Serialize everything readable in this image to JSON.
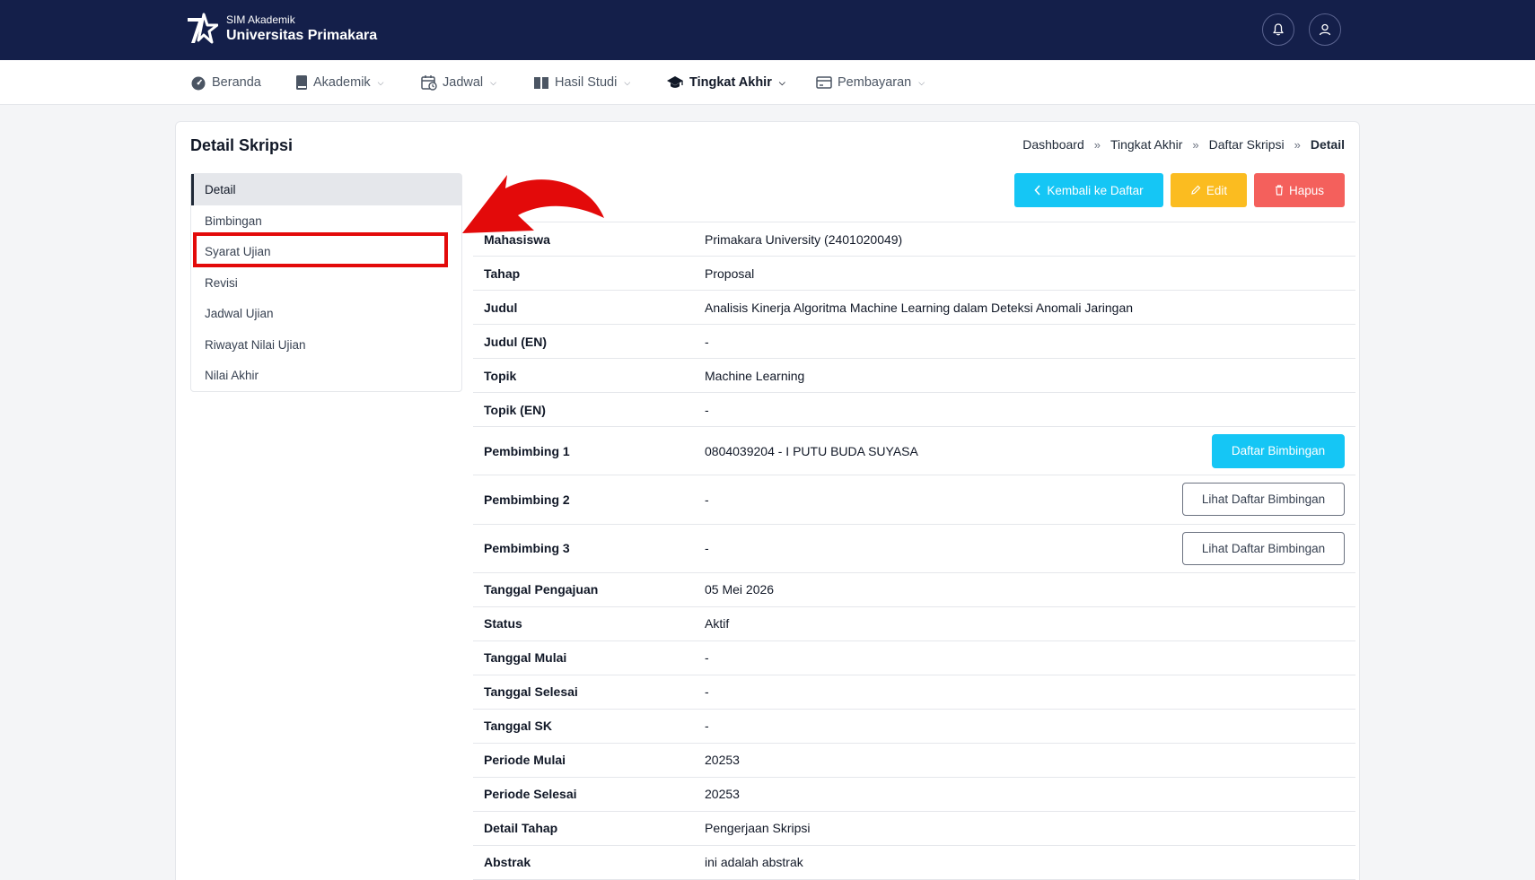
{
  "header": {
    "brand_sub": "SIM Akademik",
    "brand_name": "Universitas Primakara"
  },
  "nav": [
    {
      "label": "Beranda",
      "icon": "dashboard-icon",
      "dropdown": false
    },
    {
      "label": "Akademik",
      "icon": "book-icon",
      "dropdown": true
    },
    {
      "label": "Jadwal",
      "icon": "calendar-clock-icon",
      "dropdown": true
    },
    {
      "label": "Hasil Studi",
      "icon": "open-book-icon",
      "dropdown": true
    },
    {
      "label": "Tingkat Akhir",
      "icon": "graduation-cap-icon",
      "dropdown": true,
      "active": true
    },
    {
      "label": "Pembayaran",
      "icon": "wallet-icon",
      "dropdown": true
    }
  ],
  "page": {
    "title": "Detail Skripsi",
    "breadcrumb": [
      "Dashboard",
      "Tingkat Akhir",
      "Daftar Skripsi",
      "Detail"
    ]
  },
  "side_menu": [
    {
      "label": "Detail",
      "active": true
    },
    {
      "label": "Bimbingan"
    },
    {
      "label": "Syarat Ujian",
      "highlighted": true
    },
    {
      "label": "Revisi"
    },
    {
      "label": "Jadwal Ujian"
    },
    {
      "label": "Riwayat Nilai Ujian"
    },
    {
      "label": "Nilai Akhir"
    }
  ],
  "actions": {
    "back_label": "Kembali ke Daftar",
    "edit_label": "Edit",
    "delete_label": "Hapus"
  },
  "details": [
    {
      "label": "Mahasiswa",
      "value": "Primakara University (2401020049)"
    },
    {
      "label": "Tahap",
      "value": "Proposal"
    },
    {
      "label": "Judul",
      "value": "Analisis Kinerja Algoritma Machine Learning dalam Deteksi Anomali Jaringan"
    },
    {
      "label": "Judul (EN)",
      "value": "-"
    },
    {
      "label": "Topik",
      "value": "Machine Learning"
    },
    {
      "label": "Topik (EN)",
      "value": "-"
    },
    {
      "label": "Pembimbing 1",
      "value": "0804039204 - I PUTU BUDA SUYASA",
      "button": "Daftar Bimbingan"
    },
    {
      "label": "Pembimbing 2",
      "value": "-",
      "button": "Lihat Daftar Bimbingan"
    },
    {
      "label": "Pembimbing 3",
      "value": "-",
      "button": "Lihat Daftar Bimbingan"
    },
    {
      "label": "Tanggal Pengajuan",
      "value": "05 Mei 2026"
    },
    {
      "label": "Status",
      "value": "Aktif"
    },
    {
      "label": "Tanggal Mulai",
      "value": "-"
    },
    {
      "label": "Tanggal Selesai",
      "value": "-"
    },
    {
      "label": "Tanggal SK",
      "value": "-"
    },
    {
      "label": "Periode Mulai",
      "value": "20253"
    },
    {
      "label": "Periode Selesai",
      "value": "20253"
    },
    {
      "label": "Detail Tahap",
      "value": "Pengerjaan Skripsi"
    },
    {
      "label": "Abstrak",
      "value": "ini adalah abstrak"
    }
  ],
  "colors": {
    "header_bg": "#141f4a",
    "info": "#15c6f5",
    "warning": "#fbbc20",
    "danger": "#f4605c",
    "annotation": "#e30a0a"
  }
}
